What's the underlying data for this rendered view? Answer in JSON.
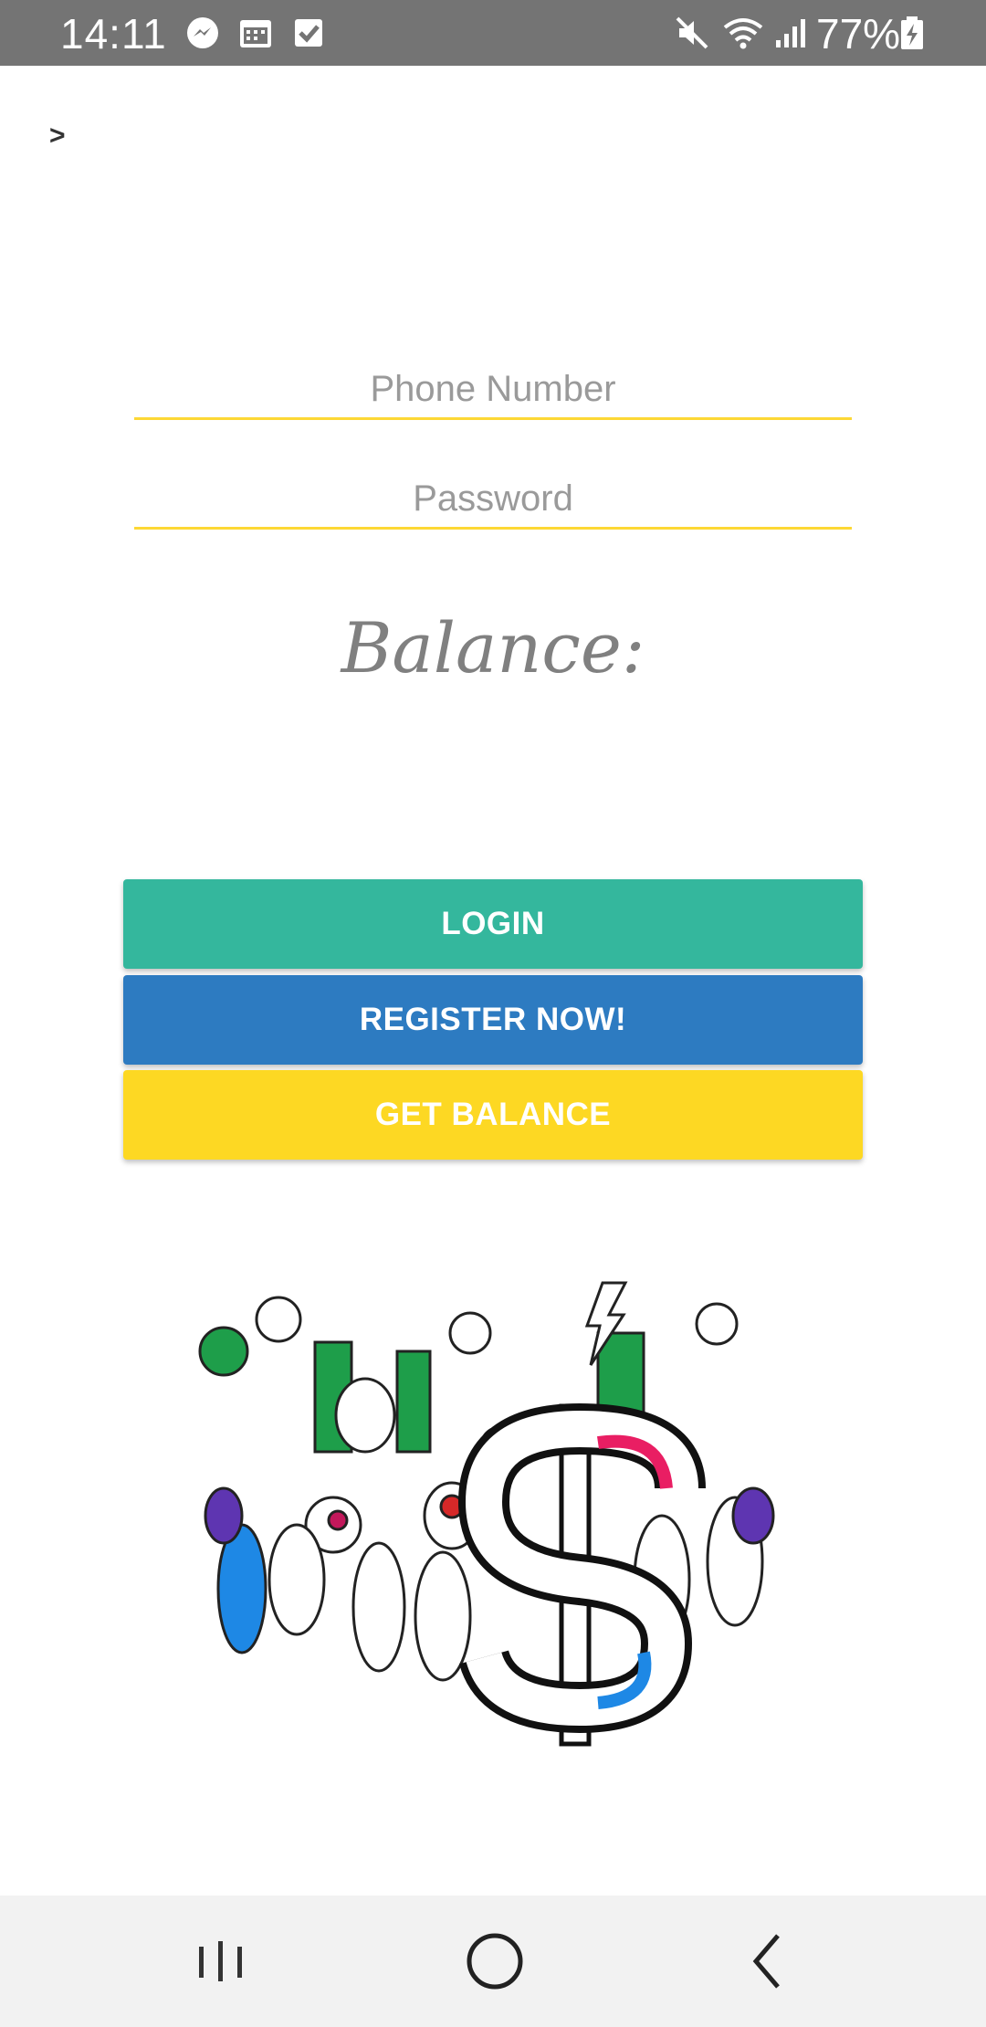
{
  "status_bar": {
    "time": "14:11",
    "battery_percent": "77%",
    "notification_icons": [
      "messenger-icon",
      "calendar-icon",
      "checkbox-icon"
    ],
    "system_icons": [
      "mute-icon",
      "wifi-icon",
      "signal-icon",
      "battery-charging-icon"
    ]
  },
  "header": {
    "back_glyph": ">"
  },
  "form": {
    "phone_placeholder": "Phone Number",
    "password_placeholder": "Password",
    "balance_label": "Balance:"
  },
  "buttons": {
    "login": "LOGIN",
    "register": "REGISTER NOW!",
    "get_balance": "GET BALANCE"
  },
  "colors": {
    "login_button": "#34b79d",
    "register_button": "#2d7bc1",
    "balance_button": "#fdd823",
    "input_underline": "#fdd835",
    "status_bar": "#747474"
  },
  "illustration": {
    "icon": "doodle-monsters-dollar-illustration"
  },
  "nav_bar": {
    "icons": [
      "recent-apps-icon",
      "home-icon",
      "back-icon"
    ]
  }
}
